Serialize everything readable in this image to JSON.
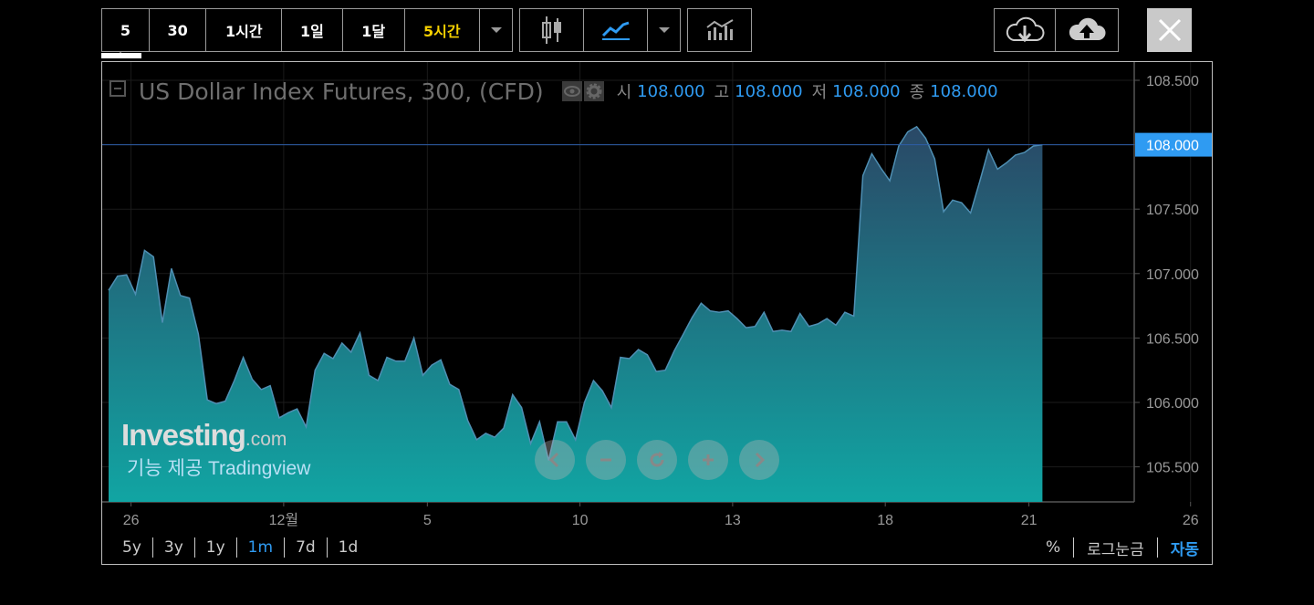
{
  "toolbar": {
    "intervals": [
      {
        "label": "5",
        "selected": false
      },
      {
        "label": "30",
        "selected": false
      },
      {
        "label": "1시간",
        "selected": false
      },
      {
        "label": "1일",
        "selected": false
      },
      {
        "label": "1달",
        "selected": false
      },
      {
        "label": "5시간",
        "selected": true
      }
    ],
    "icons": [
      "candlestick-icon",
      "line-chart-icon",
      "indicators-icon",
      "cloud-download-icon",
      "cloud-upload-icon",
      "close-icon"
    ]
  },
  "legend": {
    "title": "US Dollar Index Futures, 300, (CFD)",
    "open_label": "시",
    "open": "108.000",
    "high_label": "고",
    "high": "108.000",
    "low_label": "저",
    "low": "108.000",
    "close_label": "종",
    "close": "108.000"
  },
  "logo": {
    "brand": "Investing",
    "domain": ".com",
    "powered": "기능 제공 Tradingview"
  },
  "range_buttons": [
    {
      "label": "5y",
      "active": false
    },
    {
      "label": "3y",
      "active": false
    },
    {
      "label": "1y",
      "active": false
    },
    {
      "label": "1m",
      "active": true
    },
    {
      "label": "7d",
      "active": false
    },
    {
      "label": "1d",
      "active": false
    }
  ],
  "scale_buttons": [
    {
      "label": "%",
      "active": false
    },
    {
      "label": "로그눈금",
      "active": false
    },
    {
      "label": "자동",
      "active": true
    }
  ],
  "colors": {
    "accent": "#2f9bf2",
    "selected_interval": "#f5d000",
    "area_top": "#2a4866",
    "area_bottom": "#11a5a3",
    "line": "#4f8fb3"
  },
  "chart_data": {
    "type": "area",
    "title": "US Dollar Index Futures, 300, (CFD)",
    "xlabel": "",
    "ylabel": "",
    "ylim": [
      105.2,
      108.6
    ],
    "y_ticks": [
      105.5,
      106.0,
      106.5,
      107.0,
      107.5,
      108.0,
      108.5
    ],
    "y_tick_labels": [
      "105.500",
      "106.000",
      "106.500",
      "107.000",
      "107.500",
      "108.000",
      "108.500"
    ],
    "last_value": 108.0,
    "last_value_label": "108.000",
    "grid": true,
    "x_ticks": [
      {
        "label": "26",
        "index": 2.5
      },
      {
        "label": "12월",
        "index": 19.5
      },
      {
        "label": "5",
        "index": 35.5
      },
      {
        "label": "10",
        "index": 52.5
      },
      {
        "label": "13",
        "index": 69.5
      },
      {
        "label": "18",
        "index": 86.5
      },
      {
        "label": "21",
        "index": 102.5
      },
      {
        "label": "26",
        "index": 120.5
      }
    ],
    "series": [
      {
        "values": [
          106.87,
          106.98,
          106.99,
          106.84,
          107.18,
          107.13,
          106.62,
          107.04,
          106.83,
          106.81,
          106.53,
          106.02,
          105.99,
          106.01,
          106.17,
          106.35,
          106.18,
          106.1,
          106.13,
          105.88,
          105.92,
          105.95,
          105.81,
          106.25,
          106.38,
          106.34,
          106.46,
          106.39,
          106.54,
          106.21,
          106.17,
          106.35,
          106.32,
          106.32,
          106.5,
          106.21,
          106.29,
          106.33,
          106.14,
          106.1,
          105.86,
          105.71,
          105.76,
          105.73,
          105.8,
          106.06,
          105.96,
          105.68,
          105.85,
          105.55,
          105.85,
          105.85,
          105.71,
          106.0,
          106.17,
          106.09,
          105.96,
          106.35,
          106.34,
          106.41,
          106.37,
          106.24,
          106.25,
          106.4,
          106.53,
          106.66,
          106.77,
          106.71,
          106.7,
          106.71,
          106.65,
          106.58,
          106.59,
          106.7,
          106.55,
          106.56,
          106.55,
          106.69,
          106.59,
          106.61,
          106.65,
          106.6,
          106.7,
          106.67,
          107.76,
          107.93,
          107.82,
          107.72,
          107.99,
          108.1,
          108.14,
          108.05,
          107.89,
          107.48,
          107.57,
          107.55,
          107.47,
          107.71,
          107.96,
          107.81,
          107.86,
          107.92,
          107.94,
          107.99,
          108.0
        ]
      }
    ]
  }
}
